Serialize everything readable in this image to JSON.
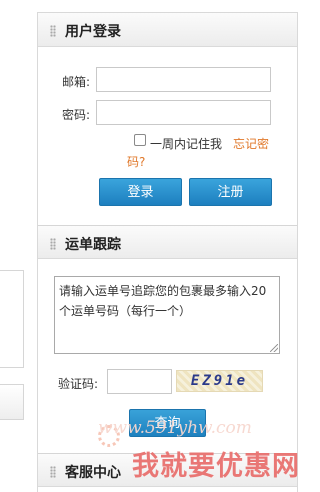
{
  "login": {
    "title": "用户登录",
    "email_label": "邮箱:",
    "email_value": "",
    "password_label": "密码:",
    "password_value": "",
    "remember_label": "一周内记住我",
    "forgot_line1": "忘记密",
    "forgot_line2": "码?",
    "login_button": "登录",
    "register_button": "注册"
  },
  "tracking": {
    "title": "运单跟踪",
    "textarea_text": "请输入运单号追踪您的包裹最多输入20个运单号码（每行一个）",
    "captcha_label": "验证码:",
    "captcha_value": "",
    "captcha_image_text": "EZ91e",
    "query_button": "查询"
  },
  "service": {
    "title": "客服中心"
  },
  "watermark": {
    "url": "www.591yhw.com",
    "text": "我就要优惠网"
  },
  "colors": {
    "accent_button": "#1d7fbf",
    "link_orange": "#e0782a",
    "watermark_red": "#e9716f"
  },
  "icons": [
    "grip-icon",
    "checkbox-icon",
    "resize-handle-icon"
  ]
}
